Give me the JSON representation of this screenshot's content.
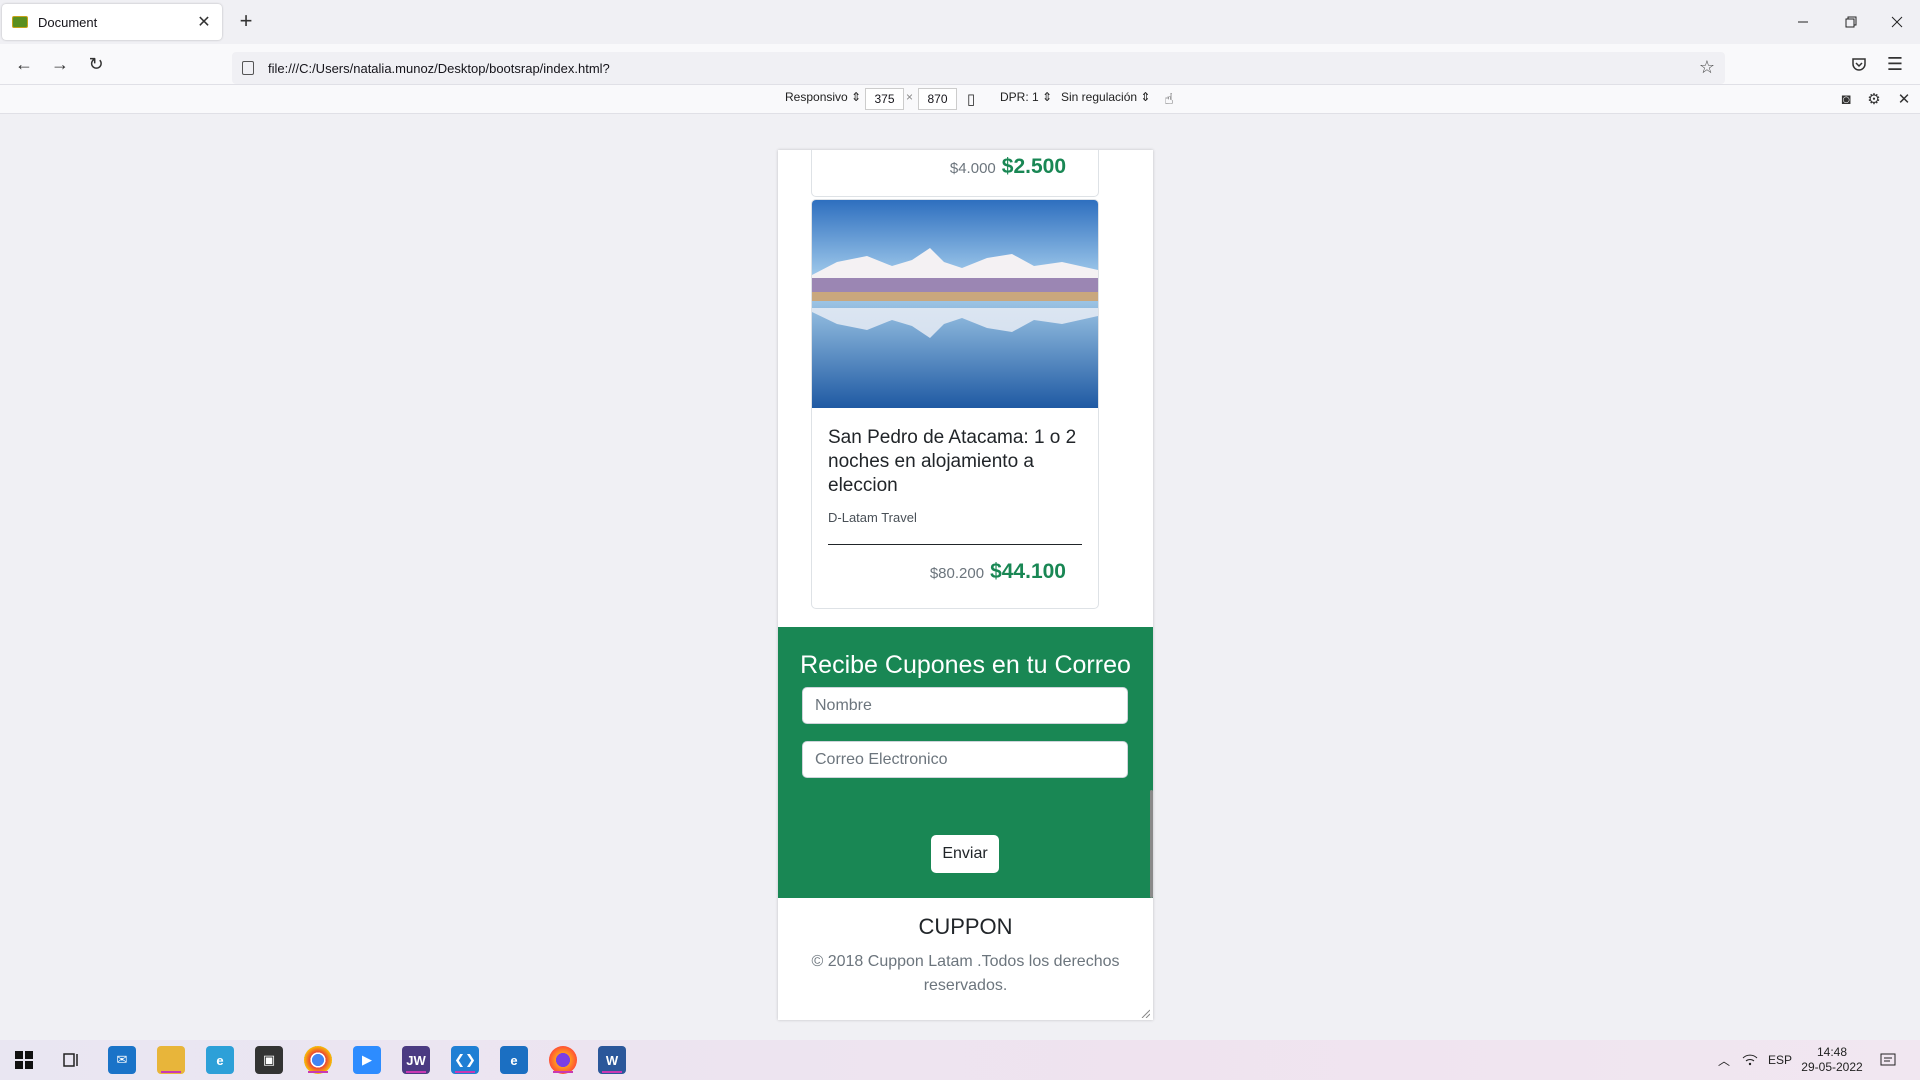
{
  "browser": {
    "tab_title": "Document",
    "url": "file:///C:/Users/natalia.munoz/Desktop/bootsrap/index.html?"
  },
  "rdm": {
    "device": "Responsivo",
    "width": "375",
    "times": "×",
    "height": "870",
    "dpr": "DPR: 1",
    "throttling": "Sin regulación"
  },
  "page": {
    "top_card": {
      "old_price": "$4.000",
      "new_price": "$2.500"
    },
    "card": {
      "title": "San Pedro de Atacama: 1 o 2 noches en alojamiento a eleccion",
      "subtitle": "D-Latam Travel",
      "old_price": "$80.200",
      "new_price": "$44.100"
    },
    "newsletter": {
      "heading": "Recibe Cupones en tu Correo",
      "name_placeholder": "Nombre",
      "email_placeholder": "Correo Electronico",
      "submit_label": "Enviar"
    },
    "footer": {
      "brand": "CUPPON",
      "copyright": "© 2018 Cuppon Latam .Todos los derechos reservados."
    }
  },
  "taskbar": {
    "apps": [
      {
        "name": "start",
        "icon": "windows-icon"
      },
      {
        "name": "task-view",
        "icon": "task-view-icon"
      },
      {
        "name": "mail",
        "icon": "mail-icon"
      },
      {
        "name": "file-explorer",
        "icon": "folder-icon"
      },
      {
        "name": "internet-explorer",
        "icon": "ie-icon"
      },
      {
        "name": "store",
        "icon": "store-icon"
      },
      {
        "name": "chrome",
        "icon": "chrome-icon"
      },
      {
        "name": "zoom",
        "icon": "zoom-icon"
      },
      {
        "name": "jw",
        "icon": "jw-icon",
        "label": "JW"
      },
      {
        "name": "vscode",
        "icon": "vscode-icon"
      },
      {
        "name": "edge",
        "icon": "edge-icon"
      },
      {
        "name": "firefox",
        "icon": "firefox-icon"
      },
      {
        "name": "word",
        "icon": "word-icon",
        "label": "W"
      }
    ],
    "language": "ESP",
    "time": "14:48",
    "date": "29-05-2022"
  }
}
